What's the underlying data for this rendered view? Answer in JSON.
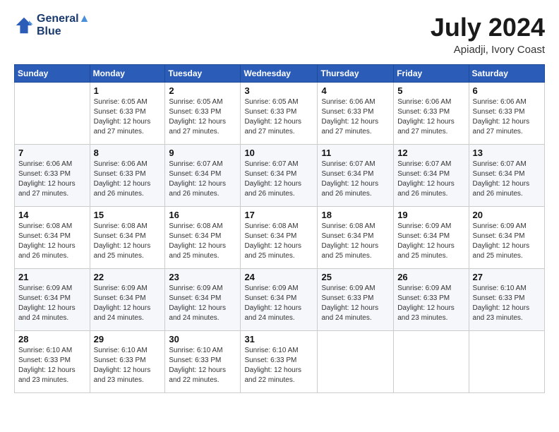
{
  "header": {
    "logo_line1": "General",
    "logo_line2": "Blue",
    "month": "July 2024",
    "location": "Apiadji, Ivory Coast"
  },
  "days_of_week": [
    "Sunday",
    "Monday",
    "Tuesday",
    "Wednesday",
    "Thursday",
    "Friday",
    "Saturday"
  ],
  "weeks": [
    [
      {
        "num": "",
        "sunrise": "",
        "sunset": "",
        "daylight": ""
      },
      {
        "num": "1",
        "sunrise": "Sunrise: 6:05 AM",
        "sunset": "Sunset: 6:33 PM",
        "daylight": "Daylight: 12 hours and 27 minutes."
      },
      {
        "num": "2",
        "sunrise": "Sunrise: 6:05 AM",
        "sunset": "Sunset: 6:33 PM",
        "daylight": "Daylight: 12 hours and 27 minutes."
      },
      {
        "num": "3",
        "sunrise": "Sunrise: 6:05 AM",
        "sunset": "Sunset: 6:33 PM",
        "daylight": "Daylight: 12 hours and 27 minutes."
      },
      {
        "num": "4",
        "sunrise": "Sunrise: 6:06 AM",
        "sunset": "Sunset: 6:33 PM",
        "daylight": "Daylight: 12 hours and 27 minutes."
      },
      {
        "num": "5",
        "sunrise": "Sunrise: 6:06 AM",
        "sunset": "Sunset: 6:33 PM",
        "daylight": "Daylight: 12 hours and 27 minutes."
      },
      {
        "num": "6",
        "sunrise": "Sunrise: 6:06 AM",
        "sunset": "Sunset: 6:33 PM",
        "daylight": "Daylight: 12 hours and 27 minutes."
      }
    ],
    [
      {
        "num": "7",
        "sunrise": "Sunrise: 6:06 AM",
        "sunset": "Sunset: 6:33 PM",
        "daylight": "Daylight: 12 hours and 27 minutes."
      },
      {
        "num": "8",
        "sunrise": "Sunrise: 6:06 AM",
        "sunset": "Sunset: 6:33 PM",
        "daylight": "Daylight: 12 hours and 26 minutes."
      },
      {
        "num": "9",
        "sunrise": "Sunrise: 6:07 AM",
        "sunset": "Sunset: 6:34 PM",
        "daylight": "Daylight: 12 hours and 26 minutes."
      },
      {
        "num": "10",
        "sunrise": "Sunrise: 6:07 AM",
        "sunset": "Sunset: 6:34 PM",
        "daylight": "Daylight: 12 hours and 26 minutes."
      },
      {
        "num": "11",
        "sunrise": "Sunrise: 6:07 AM",
        "sunset": "Sunset: 6:34 PM",
        "daylight": "Daylight: 12 hours and 26 minutes."
      },
      {
        "num": "12",
        "sunrise": "Sunrise: 6:07 AM",
        "sunset": "Sunset: 6:34 PM",
        "daylight": "Daylight: 12 hours and 26 minutes."
      },
      {
        "num": "13",
        "sunrise": "Sunrise: 6:07 AM",
        "sunset": "Sunset: 6:34 PM",
        "daylight": "Daylight: 12 hours and 26 minutes."
      }
    ],
    [
      {
        "num": "14",
        "sunrise": "Sunrise: 6:08 AM",
        "sunset": "Sunset: 6:34 PM",
        "daylight": "Daylight: 12 hours and 26 minutes."
      },
      {
        "num": "15",
        "sunrise": "Sunrise: 6:08 AM",
        "sunset": "Sunset: 6:34 PM",
        "daylight": "Daylight: 12 hours and 25 minutes."
      },
      {
        "num": "16",
        "sunrise": "Sunrise: 6:08 AM",
        "sunset": "Sunset: 6:34 PM",
        "daylight": "Daylight: 12 hours and 25 minutes."
      },
      {
        "num": "17",
        "sunrise": "Sunrise: 6:08 AM",
        "sunset": "Sunset: 6:34 PM",
        "daylight": "Daylight: 12 hours and 25 minutes."
      },
      {
        "num": "18",
        "sunrise": "Sunrise: 6:08 AM",
        "sunset": "Sunset: 6:34 PM",
        "daylight": "Daylight: 12 hours and 25 minutes."
      },
      {
        "num": "19",
        "sunrise": "Sunrise: 6:09 AM",
        "sunset": "Sunset: 6:34 PM",
        "daylight": "Daylight: 12 hours and 25 minutes."
      },
      {
        "num": "20",
        "sunrise": "Sunrise: 6:09 AM",
        "sunset": "Sunset: 6:34 PM",
        "daylight": "Daylight: 12 hours and 25 minutes."
      }
    ],
    [
      {
        "num": "21",
        "sunrise": "Sunrise: 6:09 AM",
        "sunset": "Sunset: 6:34 PM",
        "daylight": "Daylight: 12 hours and 24 minutes."
      },
      {
        "num": "22",
        "sunrise": "Sunrise: 6:09 AM",
        "sunset": "Sunset: 6:34 PM",
        "daylight": "Daylight: 12 hours and 24 minutes."
      },
      {
        "num": "23",
        "sunrise": "Sunrise: 6:09 AM",
        "sunset": "Sunset: 6:34 PM",
        "daylight": "Daylight: 12 hours and 24 minutes."
      },
      {
        "num": "24",
        "sunrise": "Sunrise: 6:09 AM",
        "sunset": "Sunset: 6:34 PM",
        "daylight": "Daylight: 12 hours and 24 minutes."
      },
      {
        "num": "25",
        "sunrise": "Sunrise: 6:09 AM",
        "sunset": "Sunset: 6:33 PM",
        "daylight": "Daylight: 12 hours and 24 minutes."
      },
      {
        "num": "26",
        "sunrise": "Sunrise: 6:09 AM",
        "sunset": "Sunset: 6:33 PM",
        "daylight": "Daylight: 12 hours and 23 minutes."
      },
      {
        "num": "27",
        "sunrise": "Sunrise: 6:10 AM",
        "sunset": "Sunset: 6:33 PM",
        "daylight": "Daylight: 12 hours and 23 minutes."
      }
    ],
    [
      {
        "num": "28",
        "sunrise": "Sunrise: 6:10 AM",
        "sunset": "Sunset: 6:33 PM",
        "daylight": "Daylight: 12 hours and 23 minutes."
      },
      {
        "num": "29",
        "sunrise": "Sunrise: 6:10 AM",
        "sunset": "Sunset: 6:33 PM",
        "daylight": "Daylight: 12 hours and 23 minutes."
      },
      {
        "num": "30",
        "sunrise": "Sunrise: 6:10 AM",
        "sunset": "Sunset: 6:33 PM",
        "daylight": "Daylight: 12 hours and 22 minutes."
      },
      {
        "num": "31",
        "sunrise": "Sunrise: 6:10 AM",
        "sunset": "Sunset: 6:33 PM",
        "daylight": "Daylight: 12 hours and 22 minutes."
      },
      {
        "num": "",
        "sunrise": "",
        "sunset": "",
        "daylight": ""
      },
      {
        "num": "",
        "sunrise": "",
        "sunset": "",
        "daylight": ""
      },
      {
        "num": "",
        "sunrise": "",
        "sunset": "",
        "daylight": ""
      }
    ]
  ]
}
